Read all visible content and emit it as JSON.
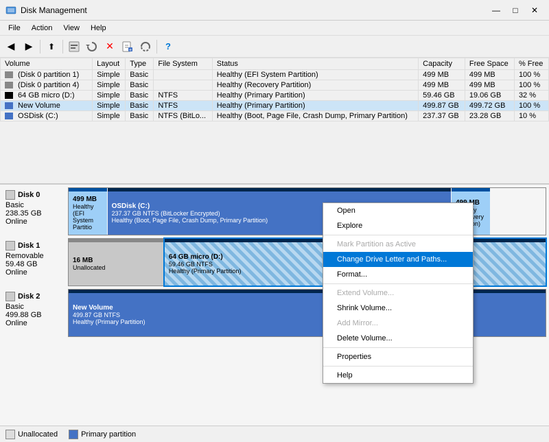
{
  "window": {
    "title": "Disk Management",
    "controls": [
      "—",
      "□",
      "✕"
    ]
  },
  "menu": {
    "items": [
      "File",
      "Action",
      "View",
      "Help"
    ]
  },
  "toolbar": {
    "buttons": [
      "◀",
      "▶",
      "⬆",
      "📋",
      "🔒",
      "✕",
      "📄",
      "🔄",
      "📤",
      "⬇"
    ]
  },
  "table": {
    "columns": [
      "Volume",
      "Layout",
      "Type",
      "File System",
      "Status",
      "Capacity",
      "Free Space",
      "% Free"
    ],
    "rows": [
      {
        "volume": "(Disk 0 partition 1)",
        "layout": "Simple",
        "type": "Basic",
        "fs": "",
        "status": "Healthy (EFI System Partition)",
        "capacity": "499 MB",
        "free": "499 MB",
        "pct": "100 %"
      },
      {
        "volume": "(Disk 0 partition 4)",
        "layout": "Simple",
        "type": "Basic",
        "fs": "",
        "status": "Healthy (Recovery Partition)",
        "capacity": "499 MB",
        "free": "499 MB",
        "pct": "100 %"
      },
      {
        "volume": "64 GB micro (D:)",
        "layout": "Simple",
        "type": "Basic",
        "fs": "NTFS",
        "status": "Healthy (Primary Partition)",
        "capacity": "59.46 GB",
        "free": "19.06 GB",
        "pct": "32 %"
      },
      {
        "volume": "New Volume",
        "layout": "Simple",
        "type": "Basic",
        "fs": "NTFS",
        "status": "Healthy (Primary Partition)",
        "capacity": "499.87 GB",
        "free": "499.72 GB",
        "pct": "100 %"
      },
      {
        "volume": "OSDisk (C:)",
        "layout": "Simple",
        "type": "Basic",
        "fs": "NTFS (BitLo...",
        "status": "Healthy (Boot, Page File, Crash Dump, Primary Partition)",
        "capacity": "237.37 GB",
        "free": "23.28 GB",
        "pct": "10 %"
      }
    ]
  },
  "disks": [
    {
      "name": "Disk 0",
      "type": "Basic",
      "size": "238.35 GB",
      "status": "Online",
      "partitions": [
        {
          "label": "499 MB",
          "sublabel": "Healthy (EFI System Partitio",
          "style": "efi",
          "width": "8%"
        },
        {
          "label": "OSDisk (C:)",
          "sublabel": "237.37 GB NTFS (BitLocker Encrypted)",
          "sublabel2": "Healthy (Boot, Page File, Crash Dump, Primary Partition)",
          "style": "main",
          "width": "72%"
        },
        {
          "label": "499 MB",
          "sublabel": "Healthy (Recovery Partition)",
          "style": "recovery",
          "width": "8%"
        }
      ]
    },
    {
      "name": "Disk 1",
      "type": "Removable",
      "size": "59.48 GB",
      "status": "Online",
      "partitions": [
        {
          "label": "16 MB",
          "sublabel": "Unallocated",
          "style": "unallocated",
          "width": "20%"
        },
        {
          "label": "64 GB micro (D:)",
          "sublabel": "59.46 GB NTFS",
          "sublabel2": "Healthy (Primary Partition)",
          "style": "selected",
          "width": "80%"
        }
      ]
    },
    {
      "name": "Disk 2",
      "type": "Basic",
      "size": "499.88 GB",
      "status": "Online",
      "partitions": [
        {
          "label": "New Volume",
          "sublabel": "499.87 GB NTFS",
          "sublabel2": "Healthy (Primary Partition)",
          "style": "main",
          "width": "100%"
        }
      ]
    }
  ],
  "context_menu": {
    "items": [
      {
        "label": "Open",
        "disabled": false,
        "highlighted": false
      },
      {
        "label": "Explore",
        "disabled": false,
        "highlighted": false
      },
      {
        "sep": true
      },
      {
        "label": "Mark Partition as Active",
        "disabled": true,
        "highlighted": false
      },
      {
        "label": "Change Drive Letter and Paths...",
        "disabled": false,
        "highlighted": true
      },
      {
        "label": "Format...",
        "disabled": false,
        "highlighted": false
      },
      {
        "sep": true
      },
      {
        "label": "Extend Volume...",
        "disabled": true,
        "highlighted": false
      },
      {
        "label": "Shrink Volume...",
        "disabled": false,
        "highlighted": false
      },
      {
        "label": "Add Mirror...",
        "disabled": true,
        "highlighted": false
      },
      {
        "label": "Delete Volume...",
        "disabled": false,
        "highlighted": false
      },
      {
        "sep": true
      },
      {
        "label": "Properties",
        "disabled": false,
        "highlighted": false
      },
      {
        "sep": true
      },
      {
        "label": "Help",
        "disabled": false,
        "highlighted": false
      }
    ]
  },
  "legend": {
    "items": [
      {
        "label": "Unallocated",
        "type": "unalloc"
      },
      {
        "label": "Primary partition",
        "type": "primary"
      }
    ]
  }
}
